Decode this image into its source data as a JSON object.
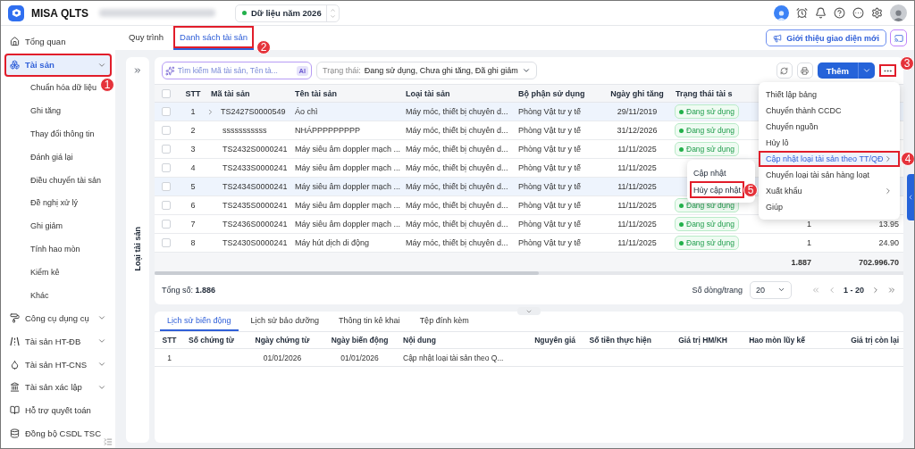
{
  "header": {
    "app_name": "MISA QLTS",
    "year_selector": {
      "label": "Dữ liệu năm 2026"
    }
  },
  "sidebar": {
    "items": [
      {
        "label": "Tổng quan",
        "kind": "link",
        "selected": false
      },
      {
        "label": "Tài sản",
        "kind": "group",
        "selected": true,
        "callout": "1",
        "children": [
          {
            "label": "Chuẩn hóa dữ liệu"
          },
          {
            "label": "Ghi tăng"
          },
          {
            "label": "Thay đổi thông tin"
          },
          {
            "label": "Đánh giá lại"
          },
          {
            "label": "Điều chuyển tài sản"
          },
          {
            "label": "Đề nghị xử lý"
          },
          {
            "label": "Ghi giảm"
          },
          {
            "label": "Tính hao mòn"
          },
          {
            "label": "Kiểm kê"
          },
          {
            "label": "Khác"
          }
        ]
      },
      {
        "label": "Công cụ dụng cụ",
        "kind": "group",
        "selected": false
      },
      {
        "label": "Tài sản HT-ĐB",
        "kind": "group",
        "selected": false
      },
      {
        "label": "Tài sản HT-CNS",
        "kind": "group",
        "selected": false
      },
      {
        "label": "Tài sản xác lập",
        "kind": "group",
        "selected": false
      },
      {
        "label": "Hỗ trợ quyết toán",
        "kind": "link",
        "selected": false
      },
      {
        "label": "Đồng bộ CSDL TSC",
        "kind": "link",
        "selected": false
      }
    ]
  },
  "tabs": [
    {
      "label": "Quy trình",
      "selected": false
    },
    {
      "label": "Danh sách tài sản",
      "selected": true,
      "callout": "2"
    }
  ],
  "intro_button": {
    "label": "Giới thiệu giao diện mới"
  },
  "side_panel": {
    "title": "Loại tài sản"
  },
  "toolbar": {
    "search": {
      "placeholder": "Tìm kiếm Mã tài sản, Tên tà...",
      "badge": "AI"
    },
    "status_filter": {
      "label": "Trạng thái:",
      "value": "Đang sử dụng, Chưa ghi tăng, Đã ghi giảm"
    },
    "add_button": {
      "label": "Thêm"
    },
    "more_button": {
      "callout": "3"
    }
  },
  "table": {
    "select_all": {
      "checked": false
    },
    "columns": [
      "STT",
      "Mã tài sản",
      "Tên tài sản",
      "Loại tài sản",
      "Bộ phận sử dụng",
      "Ngày ghi tăng",
      "Trạng thái tài s"
    ],
    "rows": [
      {
        "stt": "1",
        "code": "TS2427S0000549",
        "name": "Áo chì",
        "type": "Máy móc, thiết bị chuyên d...",
        "department": "Phòng Vật tư y tế",
        "date": "29/11/2019",
        "status": "Đang sử dụng",
        "selected": true,
        "expandable": true
      },
      {
        "stt": "2",
        "code": "sssssssssss",
        "name": "NHÁPPPPPPPPP",
        "type": "Máy móc, thiết bị chuyên d...",
        "department": "Phòng Vật tư y tế",
        "date": "31/12/2026",
        "status": "Đang sử dụng",
        "selected": false,
        "expandable": false
      },
      {
        "stt": "3",
        "code": "TS2432S0000241",
        "name": "Máy siêu âm doppler mạch ...",
        "type": "Máy móc, thiết bị chuyên d...",
        "department": "Phòng Vật tư y tế",
        "date": "11/11/2025",
        "status": "Đang sử dụng",
        "selected": false,
        "expandable": false
      },
      {
        "stt": "4",
        "code": "TS2433S0000241",
        "name": "Máy siêu âm doppler mạch ...",
        "type": "Máy móc, thiết bị chuyên d...",
        "department": "Phòng Vật tư y tế",
        "date": "11/11/2025",
        "selected": false,
        "expandable": false
      },
      {
        "stt": "5",
        "code": "TS2434S0000241",
        "name": "Máy siêu âm doppler mạch ...",
        "type": "Máy móc, thiết bị chuyên d...",
        "department": "Phòng Vật tư y tế",
        "date": "11/11/2025",
        "selected": true,
        "expandable": false
      },
      {
        "stt": "6",
        "code": "TS2435S0000241",
        "name": "Máy siêu âm doppler mạch ...",
        "type": "Máy móc, thiết bị chuyên d...",
        "department": "Phòng Vật tư y tế",
        "date": "11/11/2025",
        "status": "Đang sử dụng",
        "selected": false,
        "expandable": false
      },
      {
        "stt": "7",
        "code": "TS2436S0000241",
        "name": "Máy siêu âm doppler mạch ...",
        "type": "Máy móc, thiết bị chuyên d...",
        "department": "Phòng Vật tư y tế",
        "date": "11/11/2025",
        "status": "Đang sử dụng",
        "quantity": "1",
        "value": "13.95",
        "selected": false,
        "expandable": false
      },
      {
        "stt": "8",
        "code": "TS2430S0000241",
        "name": "Máy hút dịch di động",
        "type": "Máy móc, thiết bị chuyên d...",
        "department": "Phòng Vật tư y tế",
        "date": "11/11/2025",
        "status": "Đang sử dụng",
        "quantity": "1",
        "value": "24.90",
        "selected": false,
        "expandable": false
      }
    ],
    "totals": [
      "1.887",
      "702.996.70"
    ]
  },
  "footer": {
    "total": "Tổng số: **1.886**",
    "page_size_label": "Số dòng/trang",
    "page_size": "20",
    "range": "1 - 20"
  },
  "menu": {
    "items": [
      {
        "label": "Thiết lập bảng",
        "selected": false,
        "has_submenu": false
      },
      {
        "label": "Chuyển thành CCDC",
        "selected": false,
        "has_submenu": false
      },
      {
        "label": "Chuyển nguồn",
        "selected": false,
        "has_submenu": false
      },
      {
        "label": "Hủy lô",
        "selected": false,
        "has_submenu": false
      },
      {
        "label": "Cập nhật loại tài sản theo TT/QĐ",
        "selected": true,
        "has_submenu": true,
        "callout": "4"
      },
      {
        "label": "Chuyển loại tài sản hàng loạt",
        "selected": false,
        "has_submenu": false
      },
      {
        "label": "Xuất khẩu",
        "selected": false,
        "has_submenu": true
      },
      {
        "label": "Giúp",
        "selected": false,
        "has_submenu": false
      }
    ]
  },
  "submenu": {
    "items": [
      {
        "label": "Cập nhật"
      },
      {
        "label": "Hủy cập nhật",
        "callout": "5"
      }
    ]
  },
  "detail": {
    "tabs": [
      {
        "label": "Lịch sử biến động",
        "selected": true
      },
      {
        "label": "Lịch sử bảo dưỡng",
        "selected": false
      },
      {
        "label": "Thông tin kê khai",
        "selected": false
      },
      {
        "label": "Tệp đính kèm",
        "selected": false
      }
    ],
    "columns": [
      "STT",
      "Số chứng từ",
      "Ngày chứng từ",
      "Ngày biến động",
      "Nội dung",
      "Nguyên giá",
      "Số tiền thực hiện",
      "Giá trị HM/KH",
      "Hao mòn lũy kế",
      "Giá trị còn lại"
    ],
    "rows": [
      {
        "cells": [
          "1",
          null,
          "01/01/2026",
          "01/01/2026",
          "Cập nhật loại tài sản theo Q...",
          null,
          null,
          null,
          null,
          null
        ]
      }
    ]
  }
}
